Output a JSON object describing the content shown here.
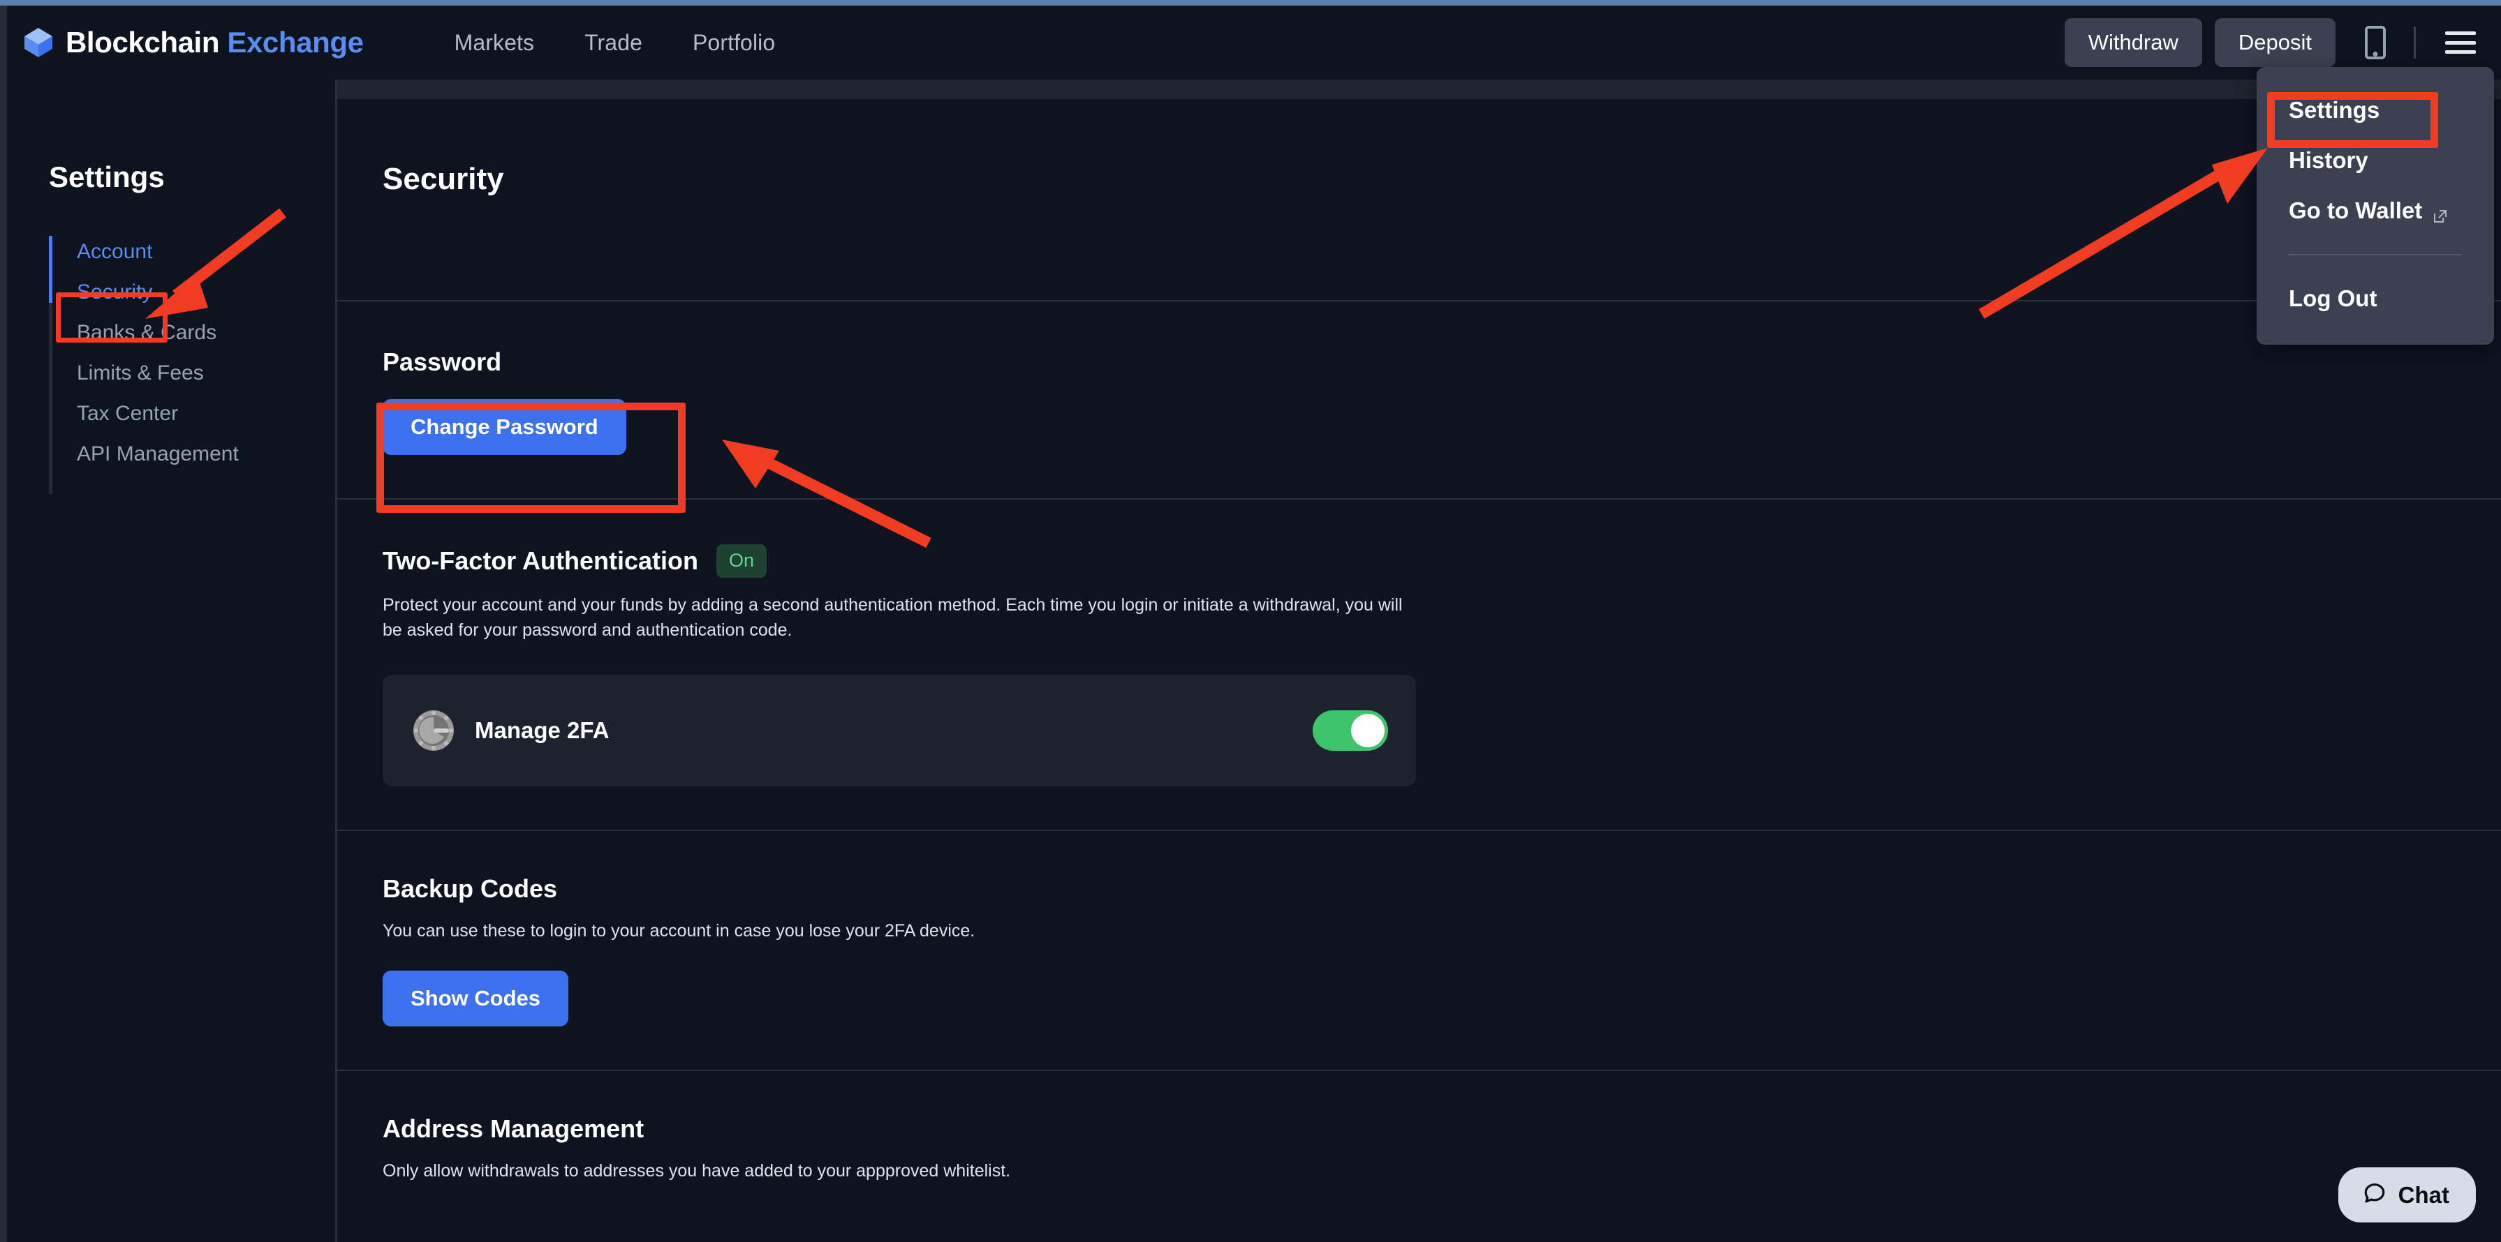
{
  "header": {
    "brand_primary": "Blockchain",
    "brand_secondary": "Exchange",
    "logo_icon": "blockchain-cube-icon",
    "nav": [
      {
        "label": "Markets"
      },
      {
        "label": "Trade"
      },
      {
        "label": "Portfolio"
      }
    ],
    "withdraw_label": "Withdraw",
    "deposit_label": "Deposit",
    "mobile_icon": "mobile-phone-icon",
    "menu_icon": "hamburger-menu-icon"
  },
  "dropdown": {
    "items": [
      {
        "label": "Settings",
        "icon": null,
        "highlighted": true
      },
      {
        "label": "History",
        "icon": null,
        "highlighted": false
      },
      {
        "label": "Go to Wallet",
        "icon": "external-link-icon",
        "highlighted": false
      }
    ],
    "logout_label": "Log Out"
  },
  "sidebar": {
    "title": "Settings",
    "items": [
      {
        "label": "Account",
        "state": "link"
      },
      {
        "label": "Security",
        "state": "active"
      },
      {
        "label": "Banks & Cards",
        "state": "default"
      },
      {
        "label": "Limits & Fees",
        "state": "default"
      },
      {
        "label": "Tax Center",
        "state": "default"
      },
      {
        "label": "API Management",
        "state": "default"
      }
    ]
  },
  "main": {
    "page_title": "Security",
    "password": {
      "title": "Password",
      "change_button": "Change Password"
    },
    "two_factor": {
      "title": "Two-Factor Authentication",
      "badge": "On",
      "description": "Protect your account and your funds by adding a second authentication method. Each time you login or initiate a withdrawal, you will be asked for your password and authentication code.",
      "card": {
        "icon": "google-authenticator-icon",
        "label": "Manage 2FA",
        "toggle_state": "on"
      }
    },
    "backup_codes": {
      "title": "Backup Codes",
      "description": "You can use these to login to your account in case you lose your 2FA device.",
      "show_button": "Show Codes"
    },
    "address_management": {
      "title": "Address Management",
      "description": "Only allow withdrawals to addresses you have added to your appproved whitelist."
    }
  },
  "chat": {
    "label": "Chat",
    "icon": "chat-bubble-icon"
  },
  "colors": {
    "page_bg": "#0e1320",
    "accent_blue": "#3d71f0",
    "brand_blue": "#5a8def",
    "toggle_green": "#3ec46d",
    "badge_green_text": "#5fd49a",
    "badge_green_bg": "#1d4231",
    "annotation_red": "#f23c22",
    "menu_bg": "#3b4150",
    "card_bg": "#1d222e"
  }
}
